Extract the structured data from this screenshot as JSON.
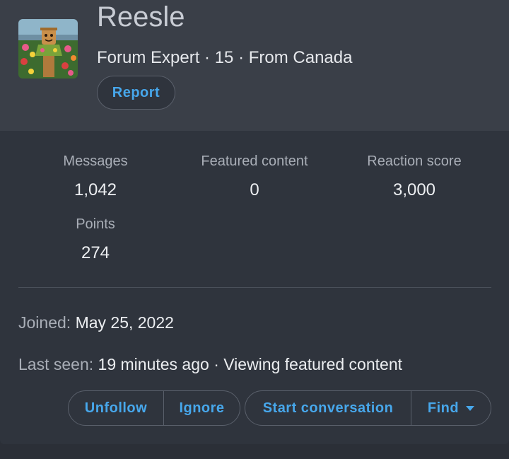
{
  "profile": {
    "username": "Reesle",
    "meta": "Forum Expert · 15 · From Canada",
    "report_label": "Report"
  },
  "stats": [
    {
      "label": "Messages",
      "value": "1,042"
    },
    {
      "label": "Featured content",
      "value": "0"
    },
    {
      "label": "Reaction score",
      "value": "3,000"
    },
    {
      "label": "Points",
      "value": "274"
    }
  ],
  "info": {
    "joined_label": "Joined:",
    "joined_value": "May 25, 2022",
    "last_seen_label": "Last seen:",
    "last_seen_value": "19 minutes ago · Viewing featured content"
  },
  "actions": {
    "unfollow": "Unfollow",
    "ignore": "Ignore",
    "start_conversation": "Start conversation",
    "find": "Find"
  },
  "colors": {
    "accent": "#47a7eb",
    "header_bg": "#3a3f48",
    "card_bg": "#2f343d"
  }
}
